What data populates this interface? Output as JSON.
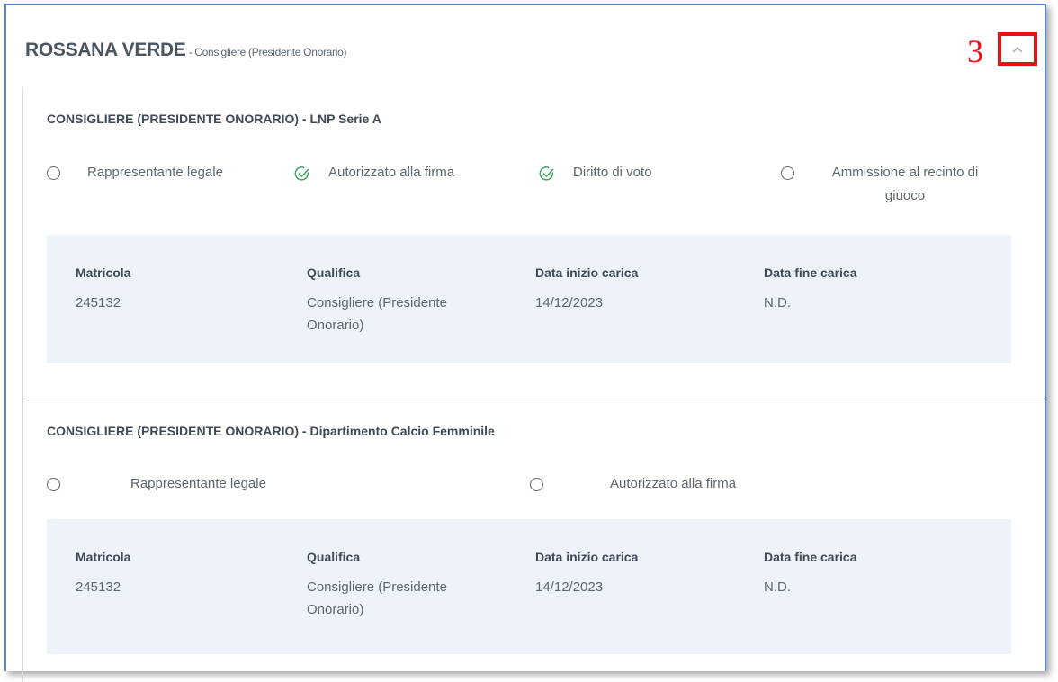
{
  "person": {
    "name": "ROSSANA VERDE",
    "role": " - Consigliere (Presidente Onorario)"
  },
  "annotation": {
    "number": "3"
  },
  "controls": {
    "collapse_icon": "chevron-up-icon"
  },
  "colors": {
    "frame_border": "#5a86c8",
    "annotation_red": "#e8101a",
    "check_green": "#3aa760",
    "info_bg": "#eef3f9"
  },
  "sections": [
    {
      "title": "CONSIGLIERE (PRESIDENTE ONORARIO) - LNP Serie A",
      "options": [
        {
          "label": "Rappresentante legale",
          "checked": false
        },
        {
          "label": "Autorizzato alla firma",
          "checked": true
        },
        {
          "label": "Diritto di voto",
          "checked": true
        },
        {
          "label": "Ammissione al recinto di giuoco",
          "checked": false
        }
      ],
      "info": {
        "matricola_label": "Matricola",
        "matricola": "245132",
        "qualifica_label": "Qualifica",
        "qualifica": "Consigliere (Presidente Onorario)",
        "inizio_label": "Data inizio carica",
        "inizio": "14/12/2023",
        "fine_label": "Data fine carica",
        "fine": "N.D."
      }
    },
    {
      "title": "CONSIGLIERE (PRESIDENTE ONORARIO) - Dipartimento Calcio Femminile",
      "options": [
        {
          "label": "Rappresentante legale",
          "checked": false
        },
        {
          "label": "Autorizzato alla firma",
          "checked": false
        }
      ],
      "info": {
        "matricola_label": "Matricola",
        "matricola": "245132",
        "qualifica_label": "Qualifica",
        "qualifica": "Consigliere (Presidente Onorario)",
        "inizio_label": "Data inizio carica",
        "inizio": "14/12/2023",
        "fine_label": "Data fine carica",
        "fine": "N.D."
      }
    }
  ]
}
